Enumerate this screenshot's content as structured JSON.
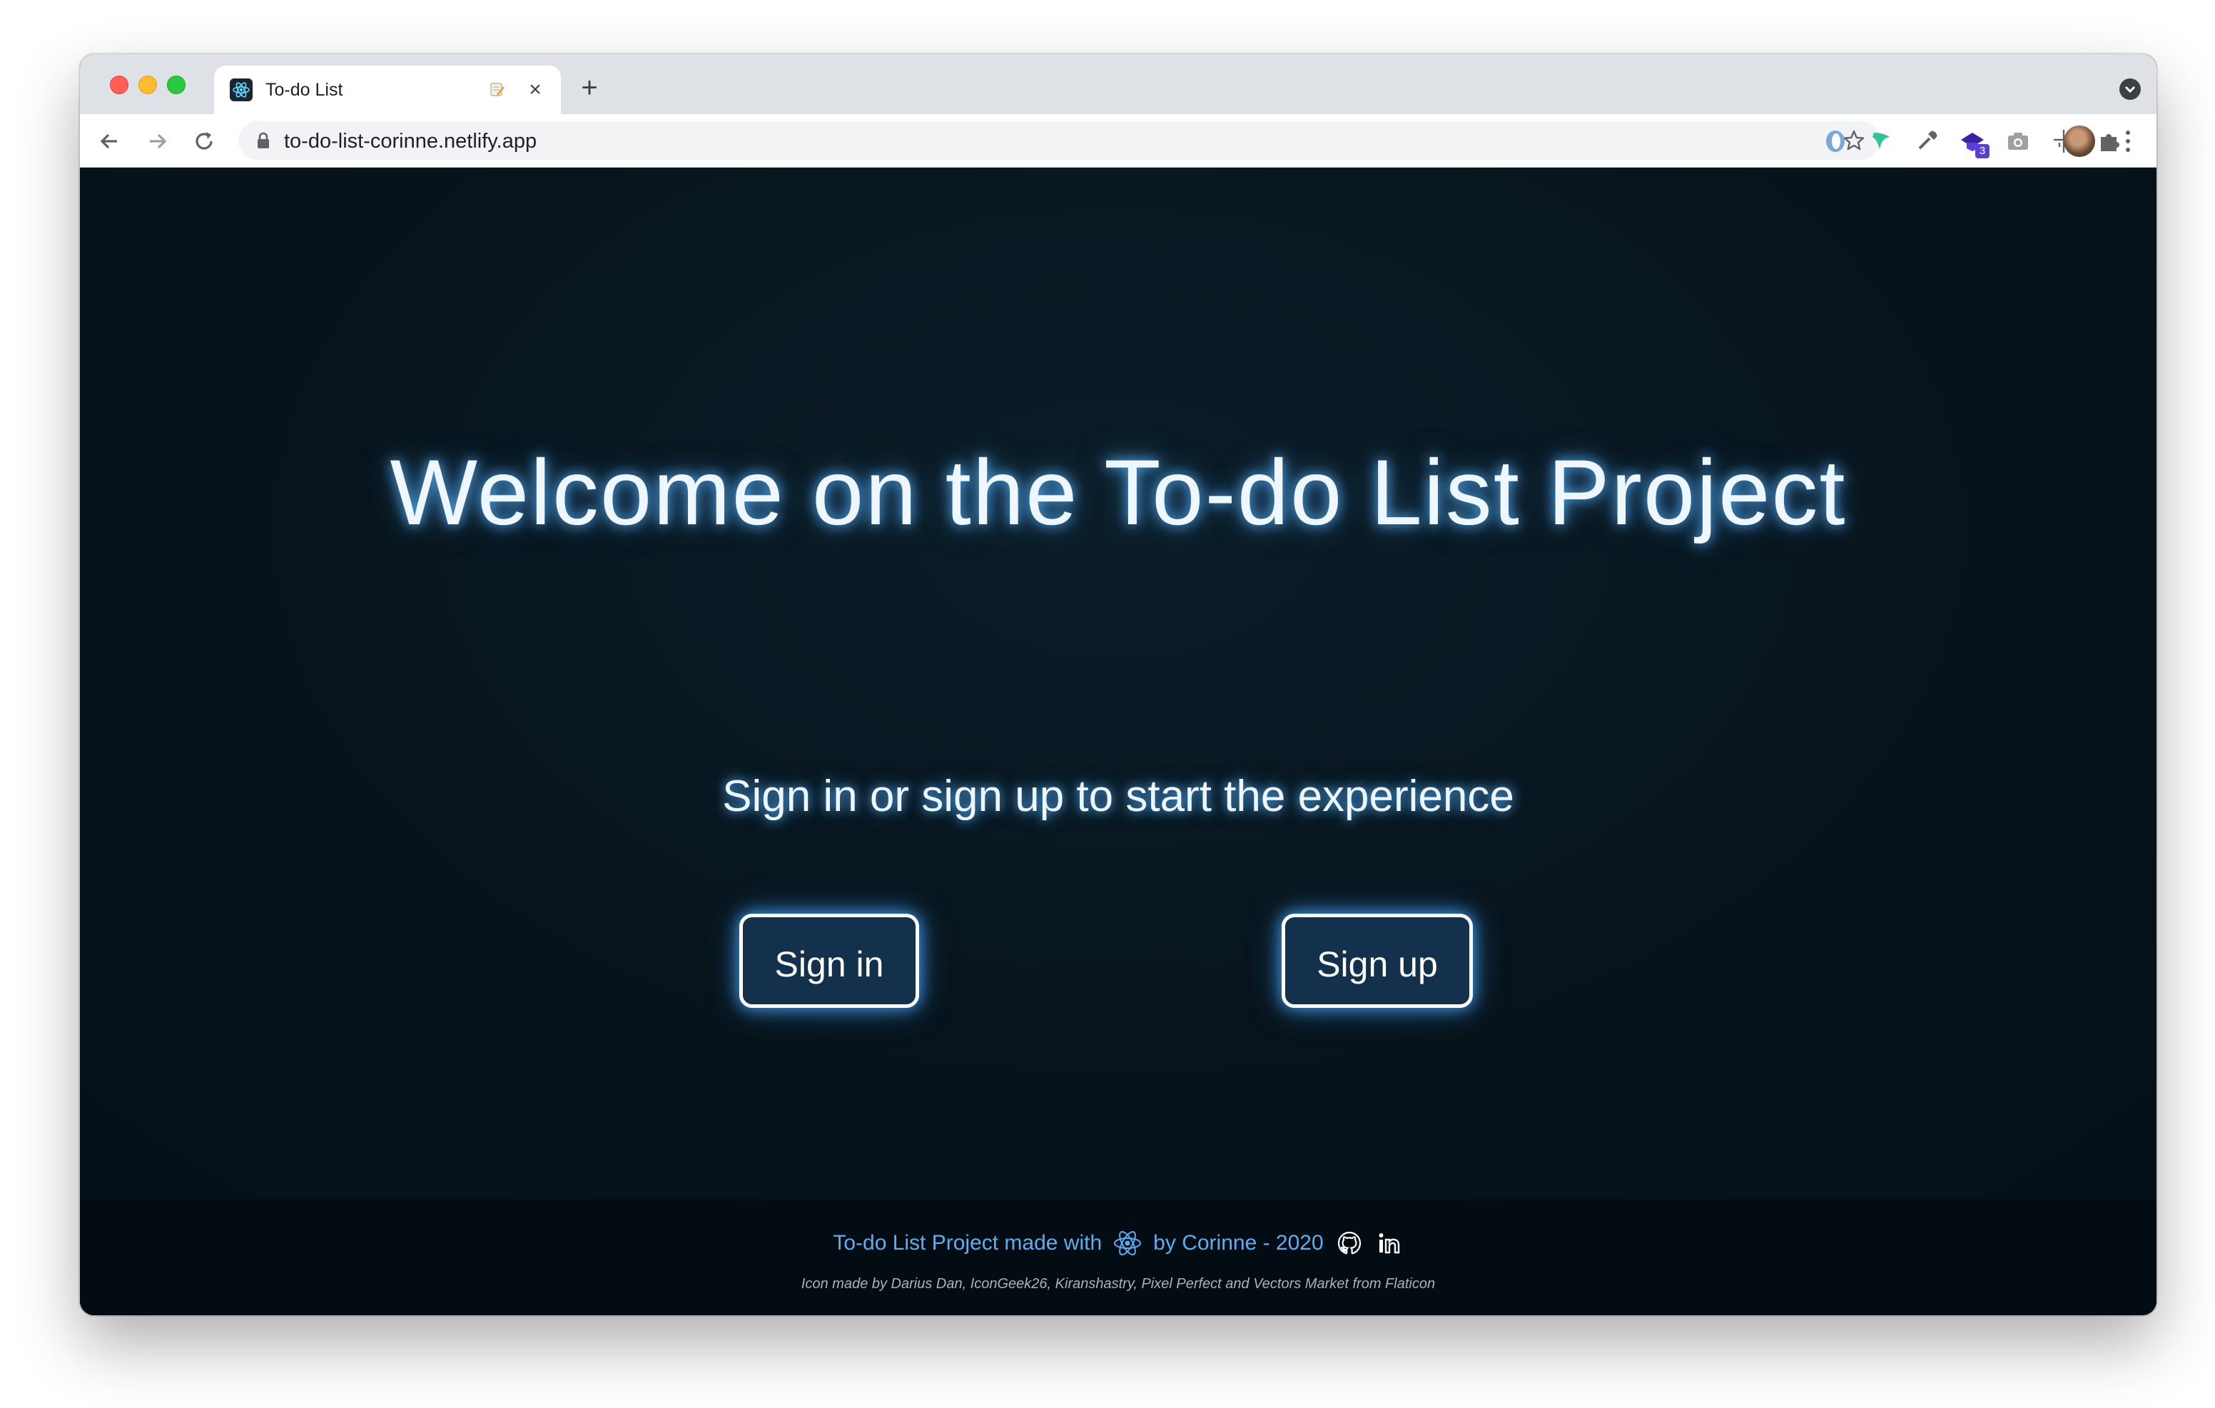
{
  "browser": {
    "tab": {
      "title": "To-do List",
      "emoji_icon": "memo-icon",
      "close_label": "×"
    },
    "new_tab_label": "+",
    "address": {
      "url": "to-do-list-corinne.netlify.app"
    },
    "extensions": [
      {
        "name": "opera-extension-icon"
      },
      {
        "name": "green-leaf-extension-icon"
      },
      {
        "name": "eyedropper-extension-icon"
      },
      {
        "name": "purple-hat-extension-icon",
        "badge": "3"
      },
      {
        "name": "camera-extension-icon"
      },
      {
        "name": "ruler-extension-icon"
      },
      {
        "name": "puzzle-extensions-icon"
      }
    ]
  },
  "page": {
    "title": "Welcome on the To-do List Project",
    "subtitle": "Sign in or sign up to start the experience",
    "signin_label": "Sign in",
    "signup_label": "Sign up"
  },
  "footer": {
    "made_with": "To-do List Project made with",
    "by_author": "by Corinne - 2020",
    "credit": "Icon made by Darius Dan, IconGeek26, Kiranshastry, Pixel Perfect and Vectors Market from Flaticon"
  },
  "colors": {
    "page_background": "#07131b",
    "accent_blue": "#5aaef2",
    "button_fill": "#13304d"
  }
}
